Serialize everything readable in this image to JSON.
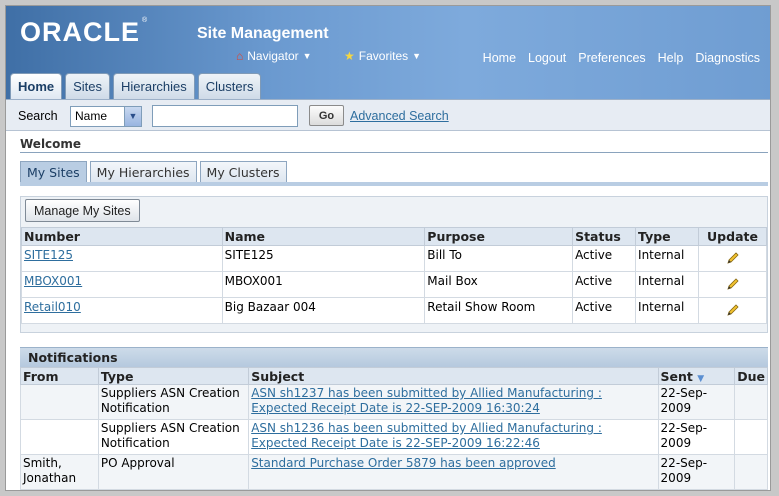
{
  "header": {
    "logo": "ORACLE",
    "logo_mark": "®",
    "app_title": "Site Management",
    "navigator": "Navigator",
    "favorites": "Favorites",
    "global_links": [
      "Home",
      "Logout",
      "Preferences",
      "Help",
      "Diagnostics"
    ]
  },
  "tabs": [
    "Home",
    "Sites",
    "Hierarchies",
    "Clusters"
  ],
  "search": {
    "label": "Search",
    "field": "Name",
    "value": "",
    "go": "Go",
    "advanced": "Advanced Search"
  },
  "welcome": "Welcome",
  "subtabs": [
    "My Sites",
    "My Hierarchies",
    "My Clusters"
  ],
  "sites": {
    "manage_button": "Manage My Sites",
    "columns": [
      "Number",
      "Name",
      "Purpose",
      "Status",
      "Type",
      "Update"
    ],
    "rows": [
      {
        "number": "SITE125",
        "name": "SITE125",
        "purpose": "Bill To",
        "status": "Active",
        "type": "Internal"
      },
      {
        "number": "MBOX001",
        "name": "MBOX001",
        "purpose": "Mail Box",
        "status": "Active",
        "type": "Internal"
      },
      {
        "number": "Retail010",
        "name": "Big Bazaar 004",
        "purpose": "Retail Show Room",
        "status": "Active",
        "type": "Internal"
      }
    ]
  },
  "notifications": {
    "title": "Notifications",
    "columns": [
      "From",
      "Type",
      "Subject",
      "Sent",
      "Due"
    ],
    "rows": [
      {
        "from": "",
        "type": "Suppliers ASN Creation Notification",
        "subject": "ASN sh1237 has been submitted by Allied Manufacturing : Expected Receipt Date is 22-SEP-2009 16:30:24",
        "sent": "22-Sep-2009",
        "due": ""
      },
      {
        "from": "",
        "type": "Suppliers ASN Creation Notification",
        "subject": "ASN sh1236 has been submitted by Allied Manufacturing : Expected Receipt Date is 22-SEP-2009 16:22:46",
        "sent": "22-Sep-2009",
        "due": ""
      },
      {
        "from": "Smith, Jonathan",
        "type": "PO Approval",
        "subject": "Standard Purchase Order 5879 has been approved",
        "sent": "22-Sep-2009",
        "due": ""
      }
    ]
  }
}
